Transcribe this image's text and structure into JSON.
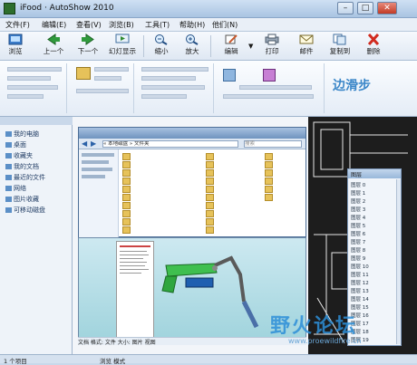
{
  "window": {
    "title": "iFood · AutoShow 2010",
    "buttons": {
      "minimize": "–",
      "maximize": "□",
      "close": "✕"
    }
  },
  "menu": [
    "文件(F)",
    "编辑(E)",
    "查看(V)",
    "浏览(B)",
    "工具(T)",
    "帮助(H)",
    "他们(N)"
  ],
  "toolbar": [
    {
      "label": "浏览",
      "icon": "browse-icon"
    },
    {
      "label": "上一个",
      "icon": "prev-icon"
    },
    {
      "label": "下一个",
      "icon": "next-icon"
    },
    {
      "label": "幻灯显示",
      "icon": "slideshow-icon"
    },
    {
      "label": "缩小",
      "icon": "zoom-out-icon"
    },
    {
      "label": "放大",
      "icon": "zoom-in-icon"
    },
    {
      "label": "编辑",
      "icon": "edit-icon"
    },
    {
      "label": "打印",
      "icon": "print-icon"
    },
    {
      "label": "邮件",
      "icon": "mail-icon"
    },
    {
      "label": "复制到",
      "icon": "copy-to-icon"
    },
    {
      "label": "删除",
      "icon": "delete-icon"
    }
  ],
  "ribbon": {
    "watermark_text": "边滑步"
  },
  "left_panel": {
    "items": [
      "我的电脑",
      "桌面",
      "收藏夹",
      "我的文档",
      "最近的文件",
      "网络",
      "图片收藏",
      "可移动磁盘"
    ]
  },
  "explorer": {
    "address": "« 本地磁盘 » 文件夹",
    "search_placeholder": "搜索"
  },
  "preview": {
    "status": "文档 格式: 文件 大小: 图片 视图"
  },
  "right_panel": {
    "title": "图层",
    "rows": [
      "图层 0",
      "图层 1",
      "图层 2",
      "图层 3",
      "图层 4",
      "图层 5",
      "图层 6",
      "图层 7",
      "图层 8",
      "图层 9",
      "图层 10",
      "图层 11",
      "图层 12",
      "图层 13",
      "图层 14",
      "图层 15",
      "图层 16",
      "图层 17",
      "图层 18",
      "图层 19"
    ]
  },
  "status_bar": {
    "left": "1 个项目",
    "middle": "浏览 模式"
  },
  "watermark": {
    "text": "野火论坛",
    "sub": "www.proewildfire.cn"
  }
}
